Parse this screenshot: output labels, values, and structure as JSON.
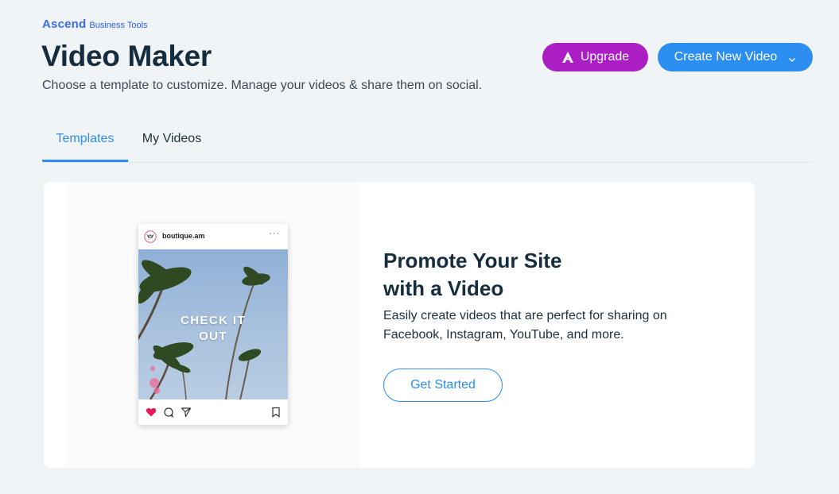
{
  "brand": {
    "logo": "Ascend",
    "product": "Business Tools"
  },
  "page": {
    "title": "Video Maker",
    "subtitle": "Choose a template to customize. Manage your videos & share them on social."
  },
  "header_buttons": {
    "upgrade_label": "Upgrade",
    "upgrade_icon": "premium-a-icon",
    "create_label": "Create New Video",
    "create_icon": "chevron-down-icon"
  },
  "tabs": [
    {
      "label": "Templates",
      "active": true
    },
    {
      "label": "My Videos",
      "active": false
    }
  ],
  "promo": {
    "title_line1": "Promote Your Site",
    "title_line2": "with a Video",
    "description_line1": "Easily create videos that are perfect for sharing on",
    "description_line2": "Facebook, Instagram, YouTube, and more.",
    "button_label": "Get Started"
  },
  "preview_post": {
    "username": "boutique.am",
    "overlay_line1": "CHECK IT",
    "overlay_line2": "OUT",
    "icons": [
      "heart-icon",
      "comment-icon",
      "share-icon",
      "bookmark-icon"
    ]
  },
  "colors": {
    "upgrade": "#aa1ec4",
    "primary": "#2b8ef0",
    "background": "#f0f4f7",
    "heart": "#e8195a"
  }
}
